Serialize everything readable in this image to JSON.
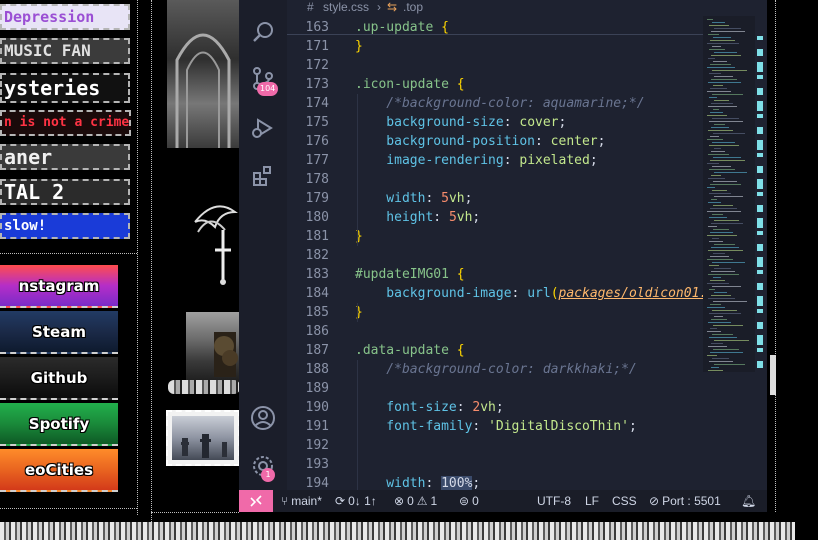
{
  "website": {
    "stamps": [
      {
        "text": "Depression",
        "bg": "#e8e4f6",
        "color": "#9b4fd4"
      },
      {
        "text": "MUSIC FAN",
        "bg": "#3b3b3b",
        "color": "#e0e0e0"
      },
      {
        "text": "ysteries",
        "bg": "#111",
        "color": "#ffffff"
      },
      {
        "text": "n is not a crime",
        "bg": "#1a0a0a",
        "color": "#ff3344"
      },
      {
        "text": "aner",
        "bg": "#3a3a3a",
        "color": "#f0f0f0"
      },
      {
        "text": "TAL 2",
        "bg": "#2b2b2b",
        "color": "#ffffff"
      },
      {
        "text": "slow!",
        "bg": "#1a3bd8",
        "color": "#ffffff"
      }
    ],
    "social_buttons": [
      {
        "label": "nstagram",
        "colors": [
          "#ff4d4d",
          "#b52ec7",
          "#7a2bc9"
        ]
      },
      {
        "label": "Steam",
        "colors": [
          "#223b64",
          "#1b2a48",
          "#0e1a2e"
        ]
      },
      {
        "label": "Github",
        "colors": [
          "#2b2b2b",
          "#1c1c1c",
          "#0b0b0b"
        ]
      },
      {
        "label": "Spotify",
        "colors": [
          "#22b04c",
          "#1a8a3a",
          "#0e5a26"
        ]
      },
      {
        "label": "eoCities",
        "colors": [
          "#ff8c2a",
          "#e96520",
          "#d33a1a"
        ]
      }
    ]
  },
  "vscode": {
    "breadcrumb": {
      "file": "style.css",
      "symbol": ".top"
    },
    "source_control_badge": "104",
    "settings_badge": "1",
    "lines": [
      {
        "n": "163",
        "tokens": [
          {
            "t": ".up-update ",
            "c": "sel"
          },
          {
            "t": "{",
            "c": "brk"
          }
        ]
      },
      {
        "n": "171",
        "tokens": [
          {
            "t": "}",
            "c": "brk"
          }
        ]
      },
      {
        "n": "172",
        "tokens": []
      },
      {
        "n": "173",
        "tokens": [
          {
            "t": ".icon-update ",
            "c": "sel"
          },
          {
            "t": "{",
            "c": "brk"
          }
        ]
      },
      {
        "n": "174",
        "tokens": [
          {
            "t": "    /*background-color: aquamarine;*/",
            "c": "cmt"
          }
        ]
      },
      {
        "n": "175",
        "tokens": [
          {
            "t": "    background-size",
            "c": "prop"
          },
          {
            "t": ": ",
            "c": ""
          },
          {
            "t": "cover",
            "c": "val"
          },
          {
            "t": ";",
            "c": ""
          }
        ]
      },
      {
        "n": "176",
        "tokens": [
          {
            "t": "    background-position",
            "c": "prop"
          },
          {
            "t": ": ",
            "c": ""
          },
          {
            "t": "center",
            "c": "val"
          },
          {
            "t": ";",
            "c": ""
          }
        ]
      },
      {
        "n": "177",
        "tokens": [
          {
            "t": "    image-rendering",
            "c": "prop"
          },
          {
            "t": ": ",
            "c": ""
          },
          {
            "t": "pixelated",
            "c": "val"
          },
          {
            "t": ";",
            "c": ""
          }
        ]
      },
      {
        "n": "178",
        "tokens": []
      },
      {
        "n": "179",
        "tokens": [
          {
            "t": "    width",
            "c": "prop"
          },
          {
            "t": ": ",
            "c": ""
          },
          {
            "t": "5",
            "c": "num"
          },
          {
            "t": "vh",
            "c": "val"
          },
          {
            "t": ";",
            "c": ""
          }
        ]
      },
      {
        "n": "180",
        "tokens": [
          {
            "t": "    height",
            "c": "prop"
          },
          {
            "t": ": ",
            "c": ""
          },
          {
            "t": "5",
            "c": "num"
          },
          {
            "t": "vh",
            "c": "val"
          },
          {
            "t": ";",
            "c": ""
          }
        ]
      },
      {
        "n": "181",
        "tokens": [
          {
            "t": "}",
            "c": "brk"
          }
        ]
      },
      {
        "n": "182",
        "tokens": []
      },
      {
        "n": "183",
        "tokens": [
          {
            "t": "#updateIMG01 ",
            "c": "sel"
          },
          {
            "t": "{",
            "c": "brk"
          }
        ]
      },
      {
        "n": "184",
        "tokens": [
          {
            "t": "    background-image",
            "c": "prop"
          },
          {
            "t": ": ",
            "c": ""
          },
          {
            "t": "url",
            "c": "fn"
          },
          {
            "t": "(",
            "c": "brk"
          },
          {
            "t": "packages/oldicon01.",
            "c": "url"
          }
        ]
      },
      {
        "n": "185",
        "tokens": [
          {
            "t": "}",
            "c": "brk"
          }
        ]
      },
      {
        "n": "186",
        "tokens": []
      },
      {
        "n": "187",
        "tokens": [
          {
            "t": ".data-update ",
            "c": "sel"
          },
          {
            "t": "{",
            "c": "brk"
          }
        ]
      },
      {
        "n": "188",
        "tokens": [
          {
            "t": "    /*background-color: darkkhaki;*/",
            "c": "cmt"
          }
        ]
      },
      {
        "n": "189",
        "tokens": []
      },
      {
        "n": "190",
        "tokens": [
          {
            "t": "    font-size",
            "c": "prop"
          },
          {
            "t": ": ",
            "c": ""
          },
          {
            "t": "2",
            "c": "num"
          },
          {
            "t": "vh",
            "c": "val"
          },
          {
            "t": ";",
            "c": ""
          }
        ]
      },
      {
        "n": "191",
        "tokens": [
          {
            "t": "    font-family",
            "c": "prop"
          },
          {
            "t": ": ",
            "c": ""
          },
          {
            "t": "'DigitalDiscoThin'",
            "c": "str"
          },
          {
            "t": ";",
            "c": ""
          }
        ]
      },
      {
        "n": "192",
        "tokens": []
      },
      {
        "n": "193",
        "tokens": []
      },
      {
        "n": "194",
        "tokens": [
          {
            "t": "    width",
            "c": "prop"
          },
          {
            "t": ": ",
            "c": ""
          },
          {
            "t": "100%",
            "c": "pct"
          },
          {
            "t": ";",
            "c": ""
          }
        ]
      }
    ],
    "status": {
      "branch": "main*",
      "sync": "0↓ 1↑",
      "errors": "0",
      "warnings": "1",
      "ports": "0",
      "encoding": "UTF-8",
      "eol": "LF",
      "language": "CSS",
      "port": "Port : 5501"
    }
  },
  "colors": {
    "remote_accent": "#f06aa9",
    "editor_bg": "#1e2230"
  }
}
